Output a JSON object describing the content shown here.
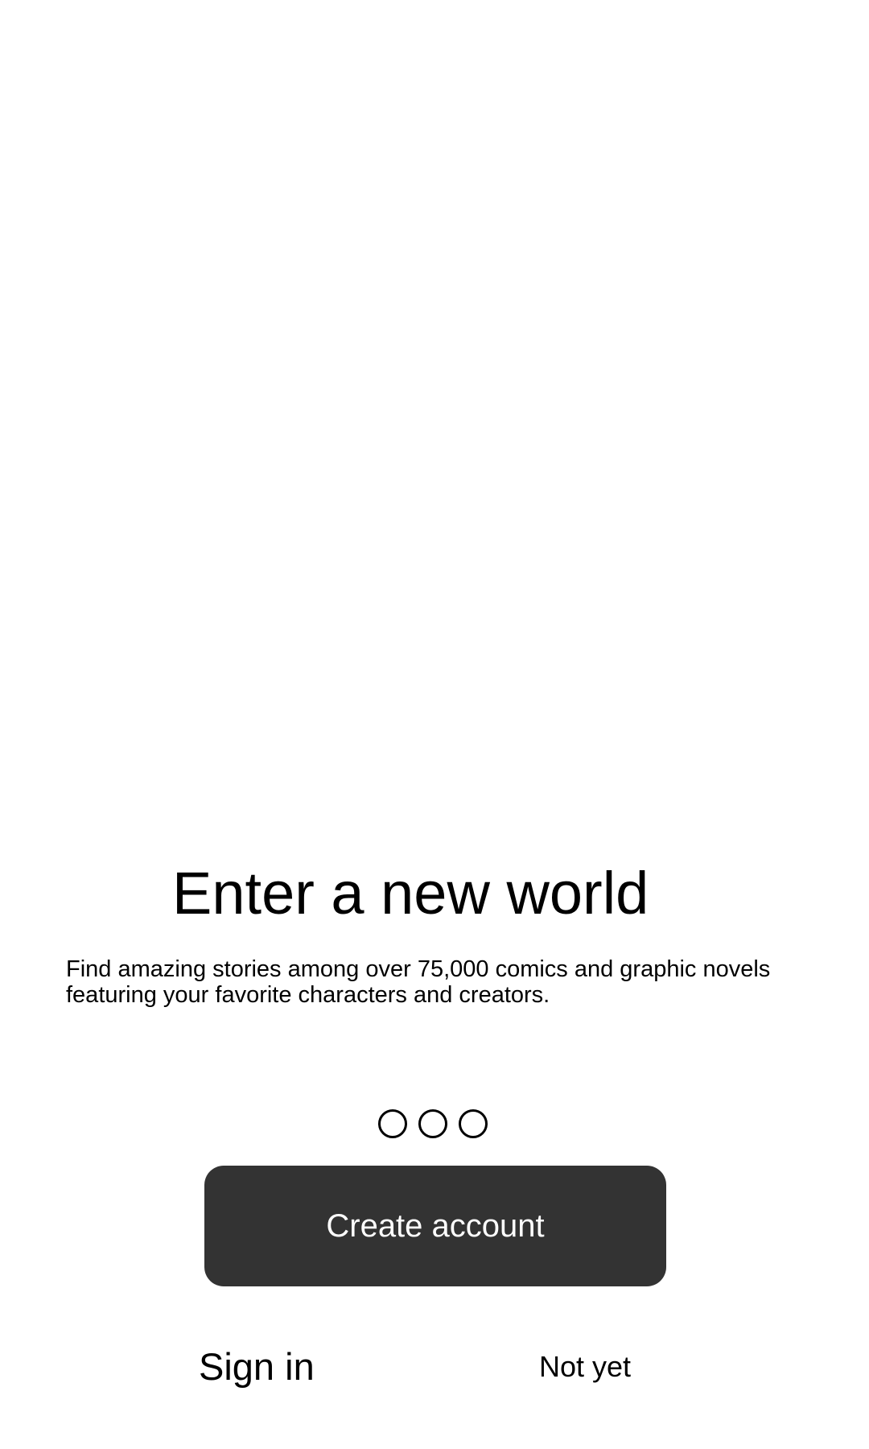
{
  "onboarding": {
    "title": "Enter a new world",
    "subtitle": "Find amazing stories among over 75,000 comics and graphic novels featuring your favorite characters and creators.",
    "pager": {
      "page_count": 3
    },
    "create_account_label": "Create account",
    "sign_in_label": "Sign in",
    "not_yet_label": "Not yet"
  },
  "colors": {
    "background": "#ffffff",
    "primary_button": "#333333",
    "primary_button_text": "#ffffff",
    "text": "#000000"
  }
}
